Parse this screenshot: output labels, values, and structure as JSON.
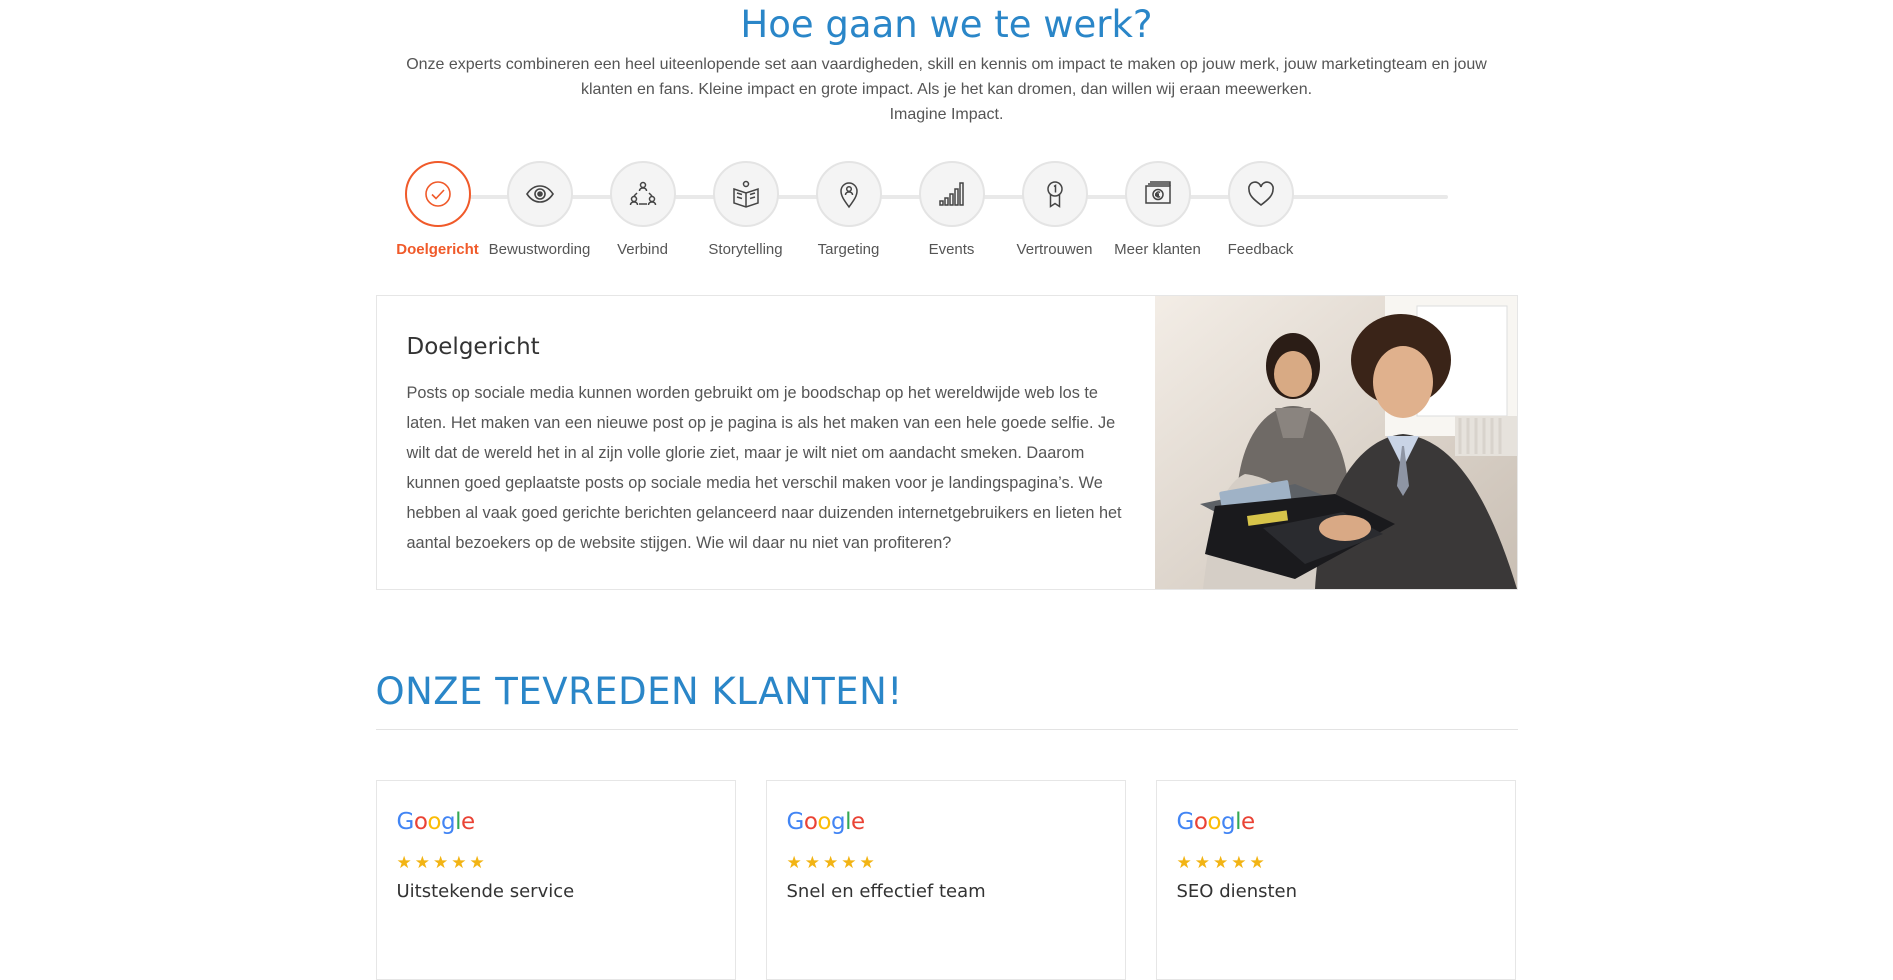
{
  "intro": {
    "title": "Hoe gaan we te werk?",
    "line1": "Onze experts combineren een heel uiteenlopende set aan vaardigheden, skill en kennis om impact te maken op jouw merk, jouw marketingteam en jouw",
    "line2": "klanten en fans. Kleine impact en grote impact. Als je het kan dromen, dan willen wij eraan meewerken.",
    "line3": "Imagine Impact."
  },
  "steps": [
    {
      "label": "Doelgericht",
      "icon": "check-circle-icon",
      "active": true
    },
    {
      "label": "Bewustwording",
      "icon": "eye-icon",
      "active": false
    },
    {
      "label": "Verbind",
      "icon": "people-connect-icon",
      "active": false
    },
    {
      "label": "Storytelling",
      "icon": "book-reader-icon",
      "active": false
    },
    {
      "label": "Targeting",
      "icon": "map-pin-person-icon",
      "active": false
    },
    {
      "label": "Events",
      "icon": "signal-bars-icon",
      "active": false
    },
    {
      "label": "Vertrouwen",
      "icon": "award-ribbon-icon",
      "active": false
    },
    {
      "label": "Meer klanten",
      "icon": "euro-cash-icon",
      "active": false
    },
    {
      "label": "Feedback",
      "icon": "heart-icon",
      "active": false
    }
  ],
  "card": {
    "title": "Doelgericht",
    "body": "Posts op sociale media kunnen worden gebruikt om je boodschap op het wereldwijde web los te laten. Het maken van een nieuwe post op je pagina is als het maken van een hele goede selfie. Je wilt dat de wereld het in al zijn volle glorie ziet, maar je wilt niet om aandacht smeken. Daarom kunnen goed geplaatste posts op sociale media het verschil maken voor je landingspagina’s. We hebben al vaak goed gerichte berichten gelanceerd naar duizenden internetgebruikers en lieten het aantal bezoekers op de website stijgen. Wie wil daar nu niet van profiteren?"
  },
  "reviews_section": {
    "title": "ONZE TEVREDEN KLANTEN!",
    "items": [
      {
        "logo": "Google",
        "stars": "★★★★★",
        "rating": 5,
        "title": "Uitstekende service"
      },
      {
        "logo": "Google",
        "stars": "★★★★★",
        "rating": 5,
        "title": "Snel en effectief team"
      },
      {
        "logo": "Google",
        "stars": "★★★★★",
        "rating": 5,
        "title": "SEO diensten"
      }
    ]
  },
  "colors": {
    "accent_blue": "#2a86c8",
    "active_orange": "#f05a2a",
    "star_gold": "#f2b414",
    "google_blue": "#4285f4",
    "google_red": "#ea4335",
    "google_yellow": "#fbbc05",
    "google_green": "#34a853"
  }
}
